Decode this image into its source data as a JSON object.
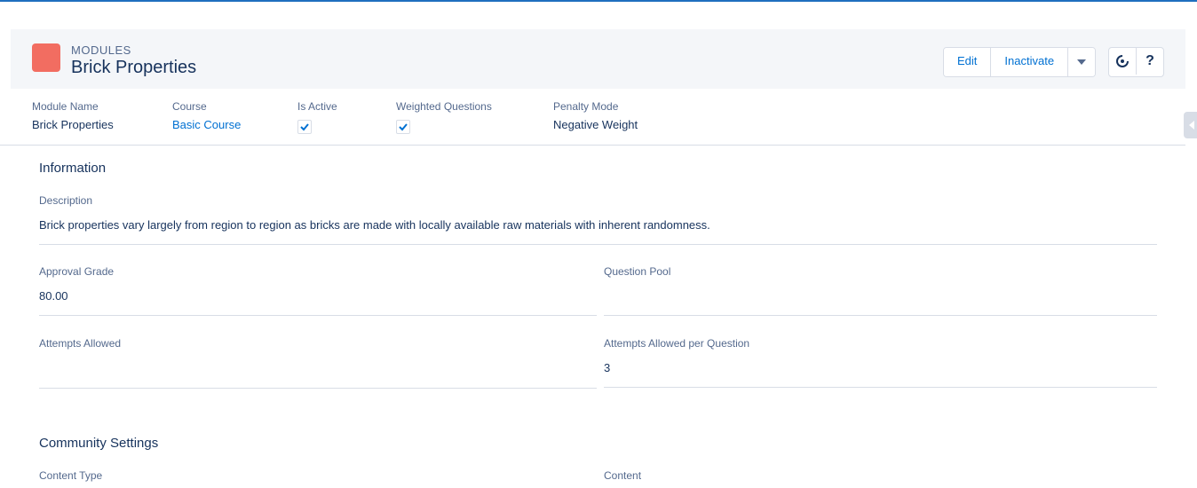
{
  "header": {
    "object_type": "MODULES",
    "title": "Brick Properties",
    "icon_color": "#f26d61",
    "actions": {
      "edit_label": "Edit",
      "inactivate_label": "Inactivate"
    },
    "icons": [
      "dropdown-caret-icon",
      "refresh-icon",
      "help-icon"
    ],
    "help_glyph": "?"
  },
  "highlights": {
    "module_name": {
      "label": "Module Name",
      "value": "Brick Properties"
    },
    "course": {
      "label": "Course",
      "value": "Basic Course"
    },
    "is_active": {
      "label": "Is Active",
      "checked": true
    },
    "weighted_questions": {
      "label": "Weighted Questions",
      "checked": true
    },
    "penalty_mode": {
      "label": "Penalty Mode",
      "value": "Negative Weight"
    }
  },
  "information": {
    "title": "Information",
    "description": {
      "label": "Description",
      "value": "Brick properties vary largely from region to region as bricks are made with locally available raw materials with inherent randomness."
    },
    "approval_grade": {
      "label": "Approval Grade",
      "value": "80.00"
    },
    "question_pool": {
      "label": "Question Pool",
      "value": ""
    },
    "attempts_allowed": {
      "label": "Attempts Allowed",
      "value": ""
    },
    "attempts_per_question": {
      "label": "Attempts Allowed per Question",
      "value": "3"
    }
  },
  "community": {
    "title": "Community Settings",
    "content_type": {
      "label": "Content Type"
    },
    "content": {
      "label": "Content"
    }
  },
  "colors": {
    "link": "#0070d2",
    "label": "#54698d",
    "text": "#16325c",
    "border": "#d8dde6",
    "header_bg": "#f4f6f9"
  }
}
